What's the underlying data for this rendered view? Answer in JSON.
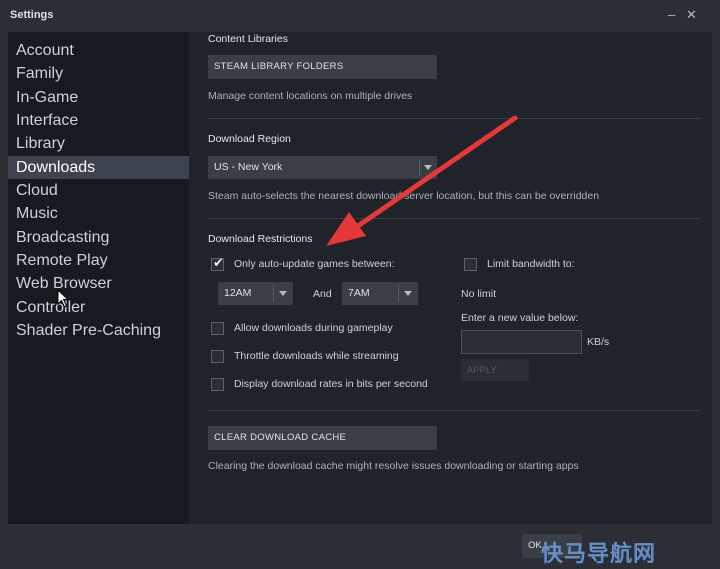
{
  "window": {
    "title": "Settings",
    "minimize_glyph": "–",
    "close_glyph": "✕"
  },
  "sidebar": {
    "items": [
      {
        "label": "Account"
      },
      {
        "label": "Family"
      },
      {
        "label": "In-Game"
      },
      {
        "label": "Interface"
      },
      {
        "label": "Library"
      },
      {
        "label": "Downloads",
        "active": true
      },
      {
        "label": "Cloud"
      },
      {
        "label": "Music"
      },
      {
        "label": "Broadcasting"
      },
      {
        "label": "Remote Play"
      },
      {
        "label": "Web Browser"
      },
      {
        "label": "Controller"
      },
      {
        "label": "Shader Pre-Caching"
      }
    ]
  },
  "content_libraries": {
    "heading": "Content Libraries",
    "button": "STEAM LIBRARY FOLDERS",
    "hint": "Manage content locations on multiple drives"
  },
  "download_region": {
    "heading": "Download Region",
    "selected": "US - New York",
    "hint": "Steam auto-selects the nearest download server location, but this can be overridden"
  },
  "download_restrictions": {
    "heading": "Download Restrictions",
    "auto_update": {
      "label": "Only auto-update games between:",
      "checked": true
    },
    "from_time": "12AM",
    "and_label": "And",
    "to_time": "7AM",
    "allow_during_gameplay": {
      "label": "Allow downloads during gameplay",
      "checked": false
    },
    "throttle_streaming": {
      "label": "Throttle downloads while streaming",
      "checked": false
    },
    "bits_per_second": {
      "label": "Display download rates in bits per second",
      "checked": false
    },
    "limit_bandwidth": {
      "label": "Limit bandwidth to:",
      "checked": false
    },
    "limit_value": "No limit",
    "enter_value_label": "Enter a new value below:",
    "unit": "KB/s",
    "apply_button": "APPLY"
  },
  "cache": {
    "button": "CLEAR DOWNLOAD CACHE",
    "hint": "Clearing the download cache might resolve issues downloading or starting apps"
  },
  "footer": {
    "ok_button": "OK",
    "watermark": "快马导航网"
  },
  "colors": {
    "accent_arrow": "#e5383b",
    "active_item": "#3d4450",
    "sidebar_bg": "#171a21",
    "panel_bg": "#202329"
  }
}
